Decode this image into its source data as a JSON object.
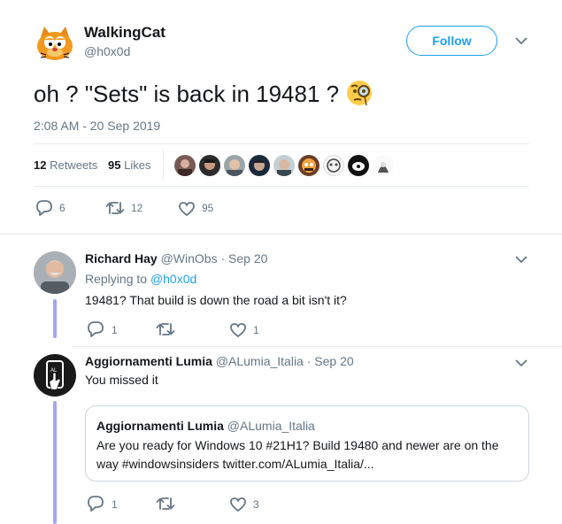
{
  "main_tweet": {
    "display_name": "WalkingCat",
    "handle": "@h0x0d",
    "follow_label": "Follow",
    "text": "oh ? \"Sets\" is back in 19481 ? ",
    "emoji_name": "face-with-monocle-emoji",
    "timestamp": "2:08 AM - 20 Sep 2019",
    "retweets_count": "12",
    "retweets_label": "Retweets",
    "likes_count": "95",
    "likes_label": "Likes",
    "actions": {
      "replies": "6",
      "retweets": "12",
      "likes": "95"
    }
  },
  "replies": [
    {
      "display_name": "Richard Hay",
      "handle": "@WinObs",
      "date": "· Sep 20",
      "replying_prefix": "Replying to",
      "replying_handle": "@h0x0d",
      "text": "19481? That build is down the road a bit isn't it?",
      "actions": {
        "replies": "1",
        "retweets": "",
        "likes": "1"
      }
    },
    {
      "display_name": "Aggiornamenti Lumia",
      "handle": "@ALumia_Italia",
      "date": "· Sep 20",
      "text": "You missed it",
      "quoted": {
        "display_name": "Aggiornamenti Lumia",
        "handle": "@ALumia_Italia",
        "text_line1": "Are you ready for Windows 10 #21H1? Build 19480 and newer are on the",
        "text_line2": "way #windowsinsiders twitter.com/ALumia_Italia/..."
      },
      "actions": {
        "replies": "1",
        "retweets": "",
        "likes": "3"
      }
    }
  ],
  "colors": {
    "accent": "#1da1f2",
    "thread_line": "#a7a4f2",
    "muted": "#657786"
  }
}
